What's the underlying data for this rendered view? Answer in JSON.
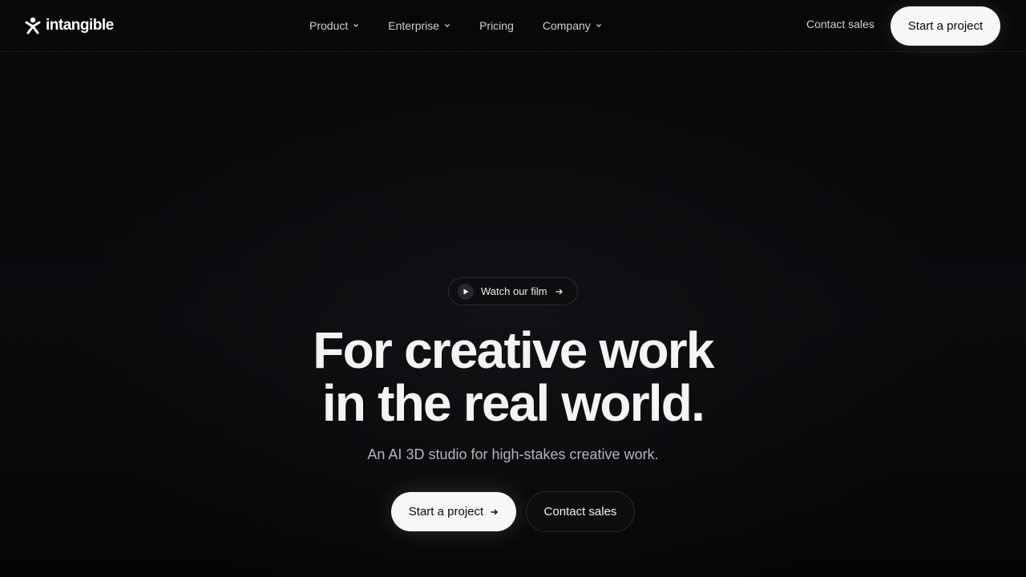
{
  "header": {
    "logo_text": "intangible",
    "nav": [
      {
        "label": "Product",
        "has_dropdown": true
      },
      {
        "label": "Enterprise",
        "has_dropdown": true
      },
      {
        "label": "Pricing",
        "has_dropdown": false
      },
      {
        "label": "Company",
        "has_dropdown": true
      }
    ],
    "contact_label": "Contact sales",
    "cta_label": "Start a project"
  },
  "hero": {
    "film_pill_label": "Watch our film",
    "headline_line1": "For creative work",
    "headline_line2": "in the real world.",
    "subhead": "An AI 3D studio for high-stakes creative work.",
    "primary_cta": "Start a project",
    "secondary_cta": "Contact sales"
  },
  "icons": {
    "logo": "person-figure-icon",
    "dropdown": "chevron-down-icon",
    "play": "play-icon",
    "arrow": "arrow-right-icon"
  },
  "colors": {
    "background": "#060608",
    "button_light": "#f7f7f8",
    "text_primary": "#f4f4f5",
    "text_muted": "#b4b4b9"
  }
}
